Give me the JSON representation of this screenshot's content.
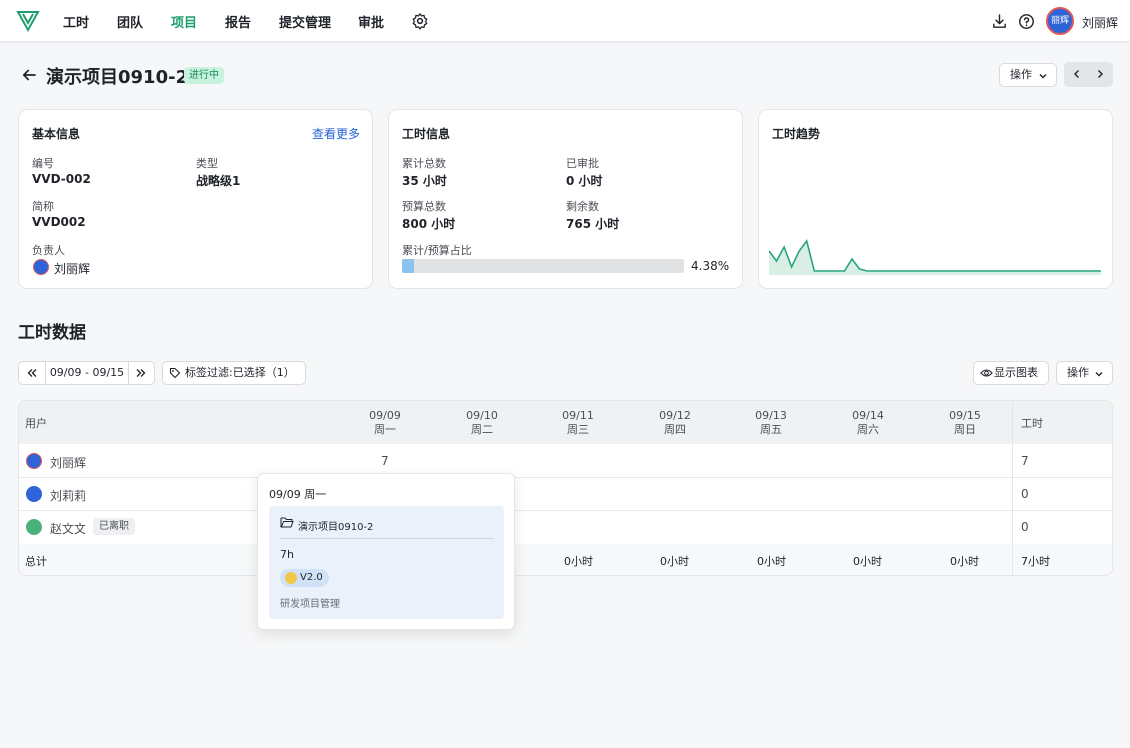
{
  "nav": {
    "items": [
      "工时",
      "团队",
      "项目",
      "报告",
      "提交管理",
      "审批"
    ],
    "active_index": 2,
    "user_name": "刘丽辉",
    "avatar_text": "丽辉"
  },
  "header": {
    "title": "演示项目0910-2",
    "status": "进行中",
    "action_label": "操作"
  },
  "basic_info": {
    "title": "基本信息",
    "more_link": "查看更多",
    "code_label": "编号",
    "code_value": "VVD-002",
    "type_label": "类型",
    "type_value": "战略级1",
    "short_label": "简称",
    "short_value": "VVD002",
    "owner_label": "负责人",
    "owner_value": "刘丽辉"
  },
  "hours_info": {
    "title": "工时信息",
    "total_label": "累计总数",
    "total_value": "35 小时",
    "approved_label": "已审批",
    "approved_value": "0 小时",
    "budget_label": "预算总数",
    "budget_value": "800 小时",
    "remaining_label": "剩余数",
    "remaining_value": "765 小时",
    "ratio_label": "累计/预算占比",
    "ratio_text": "4.38%",
    "ratio_value": 0.0438
  },
  "trend": {
    "title": "工时趋势"
  },
  "colors": {
    "accent": "#1f9e6e",
    "link": "#2662d9",
    "status_bg": "#c8f1de",
    "progress": "#8cc4f1",
    "trend_line": "#2aa57a"
  },
  "chart_data": {
    "type": "area",
    "title": "",
    "values": [
      12,
      7,
      14,
      4,
      12,
      17,
      2,
      2,
      2,
      2,
      2,
      8,
      3,
      2,
      2,
      2,
      2,
      2,
      2,
      2,
      2,
      2,
      2,
      2,
      2,
      2,
      2,
      2,
      2,
      2,
      2,
      2,
      2,
      2,
      2,
      2,
      2,
      2,
      2,
      2,
      2,
      2,
      2,
      2,
      2
    ],
    "ylim": [
      0,
      20
    ],
    "grid": false,
    "legend": "none"
  },
  "hours_data": {
    "section_title": "工时数据",
    "date_range": "09/09 - 09/15",
    "tag_filter": "标签过滤:已选择（1）",
    "show_chart_label": "显示图表",
    "action_label": "操作",
    "col_user": "用户",
    "col_hours": "工时",
    "days": [
      {
        "date": "09/09",
        "weekday": "周一"
      },
      {
        "date": "09/10",
        "weekday": "周二"
      },
      {
        "date": "09/11",
        "weekday": "周三"
      },
      {
        "date": "09/12",
        "weekday": "周四"
      },
      {
        "date": "09/13",
        "weekday": "周五"
      },
      {
        "date": "09/14",
        "weekday": "周六"
      },
      {
        "date": "09/15",
        "weekday": "周日"
      }
    ],
    "rows": [
      {
        "name": "刘丽辉",
        "day0": "7",
        "total": "7"
      },
      {
        "name": "刘莉莉",
        "total": "0"
      },
      {
        "name": "赵文文",
        "badge": "已离职",
        "total": "0"
      }
    ],
    "totals": {
      "label": "总计",
      "day2": "0小时",
      "day3": "0小时",
      "day4": "0小时",
      "day5": "0小时",
      "day6": "0小时",
      "total": "7小时"
    }
  },
  "popover": {
    "date": "09/09 周一",
    "project": "演示项目0910-2",
    "hours": "7h",
    "tag": "V2.0",
    "desc": "研发项目管理"
  }
}
